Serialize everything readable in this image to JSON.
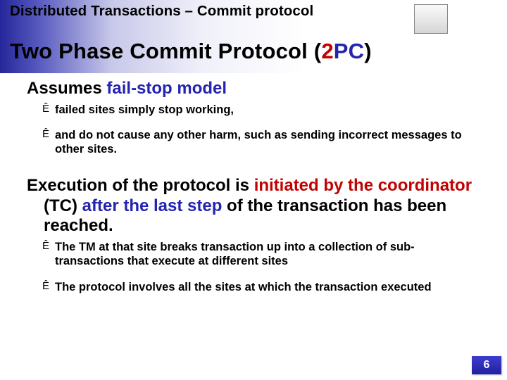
{
  "breadcrumb": "Distributed Transactions – Commit protocol",
  "title": {
    "pre": "Two Phase Commit Protocol (",
    "accent2": "2",
    "accent_nav": "PC",
    "post": ")"
  },
  "sections": [
    {
      "heading": {
        "plain_pre": "Assumes ",
        "nav": "fail-stop model",
        "red": "",
        "plain_post": ""
      },
      "items": [
        "failed sites simply stop working,",
        "and do not cause any other harm, such as sending incorrect messages to other sites."
      ]
    },
    {
      "heading": {
        "plain_pre": "Execution of the protocol is ",
        "red": "initiated by the coordinator",
        "plain_mid": "  (TC) ",
        "nav": "after the last step",
        "plain_post": " of the transaction has been reached."
      },
      "items": [
        "The TM at that site breaks transaction up into a collection of sub-transactions that execute at different sites",
        "The protocol involves all the sites at which the transaction executed"
      ]
    }
  ],
  "page_number": "6"
}
